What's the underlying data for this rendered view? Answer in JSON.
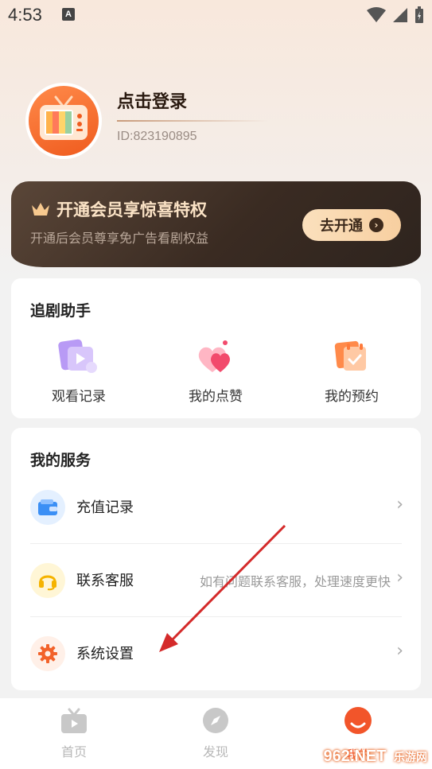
{
  "status_bar": {
    "time": "4:53",
    "notif_letter": "A"
  },
  "profile": {
    "login_label": "点击登录",
    "user_id": "ID:823190895"
  },
  "vip": {
    "title": "开通会员享惊喜特权",
    "subtitle": "开通后会员尊享免广告看剧权益",
    "button_label": "去开通"
  },
  "assistant": {
    "title": "追剧助手",
    "items": [
      {
        "label": "观看记录",
        "icon": "history-icon"
      },
      {
        "label": "我的点赞",
        "icon": "heart-icon"
      },
      {
        "label": "我的预约",
        "icon": "reservation-icon"
      }
    ]
  },
  "services": {
    "title": "我的服务",
    "items": [
      {
        "label": "充值记录",
        "hint": "",
        "icon": "wallet-icon"
      },
      {
        "label": "联系客服",
        "hint": "如有问题联系客服，处理速度更快",
        "icon": "headset-icon"
      },
      {
        "label": "系统设置",
        "hint": "",
        "icon": "gear-icon"
      }
    ]
  },
  "nav": {
    "items": [
      {
        "label": "首页",
        "icon": "tv-icon"
      },
      {
        "label": "发现",
        "icon": "compass-icon"
      },
      {
        "label": "我的",
        "icon": "profile-icon"
      }
    ]
  },
  "watermark": {
    "text": "962.NET",
    "sub": "乐游网"
  },
  "colors": {
    "accent": "#ef5b1e",
    "vip_gold": "#fbe0bd",
    "vip_dark": "#3a2b22"
  }
}
